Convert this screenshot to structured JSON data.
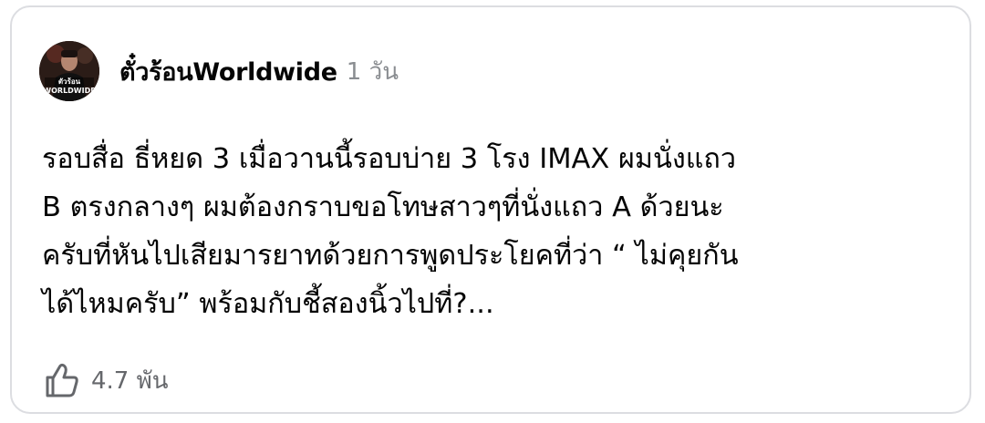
{
  "post": {
    "author": "ตั๋วร้อนWorldwide",
    "time": "1 วัน",
    "avatar_text_top": "ตัวร้อน",
    "avatar_text_bottom": "WORLDWIDE",
    "body": "รอบสื่อ ธี่หยด 3 เมื่อวานนี้รอบบ่าย 3 โรง IMAX ผมนั่งแถว\nB ตรงกลางๆ ผมต้องกราบขอโทษสาวๆที่นั่งแถว A ด้วยนะ\nครับที่หันไปเสียมารยาทด้วยการพูดประโยคที่ว่า “ ไม่คุยกัน\nได้ไหมครับ” พร้อมกับชี้สองนิ้วไปที่?...",
    "like_count": "4.7 พัน"
  },
  "icons": {
    "like": "thumbs-up-icon"
  },
  "colors": {
    "card_border": "#dcdde1",
    "secondary_text": "#65676b",
    "time_text": "#8a8d91"
  }
}
